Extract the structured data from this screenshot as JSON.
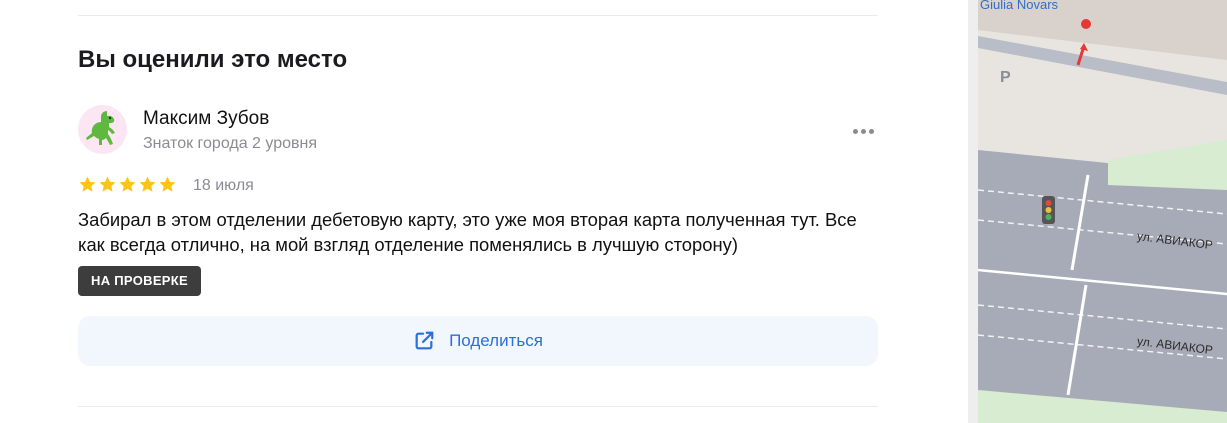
{
  "section": {
    "title": "Вы оценили это место"
  },
  "review": {
    "author_name": "Максим Зубов",
    "author_level": "Знаток города 2 уровня",
    "rating": 5,
    "date": "18 июля",
    "text": "Забирал в этом отделении дебетовую карту, это уже моя вторая карта полученная тут. Все как всегда отлично, на мой взгляд отделение поменялись в лучшую сторону)",
    "status_badge": "НА ПРОВЕРКЕ",
    "avatar_icon": "dinosaur-icon",
    "more_icon": "more-dots-icon"
  },
  "share": {
    "label": "Поделиться",
    "icon": "share-icon"
  },
  "map": {
    "poi_label": "Giulia Novars",
    "street_label_upper": "ул. АВИАКОР",
    "street_label_lower": "ул. АВИАКОР",
    "parking_label": "P"
  },
  "colors": {
    "accent": "#2a6fdb",
    "star": "#fcc419",
    "badge_bg": "#3d3d3d",
    "share_bg": "#f2f6fd"
  }
}
